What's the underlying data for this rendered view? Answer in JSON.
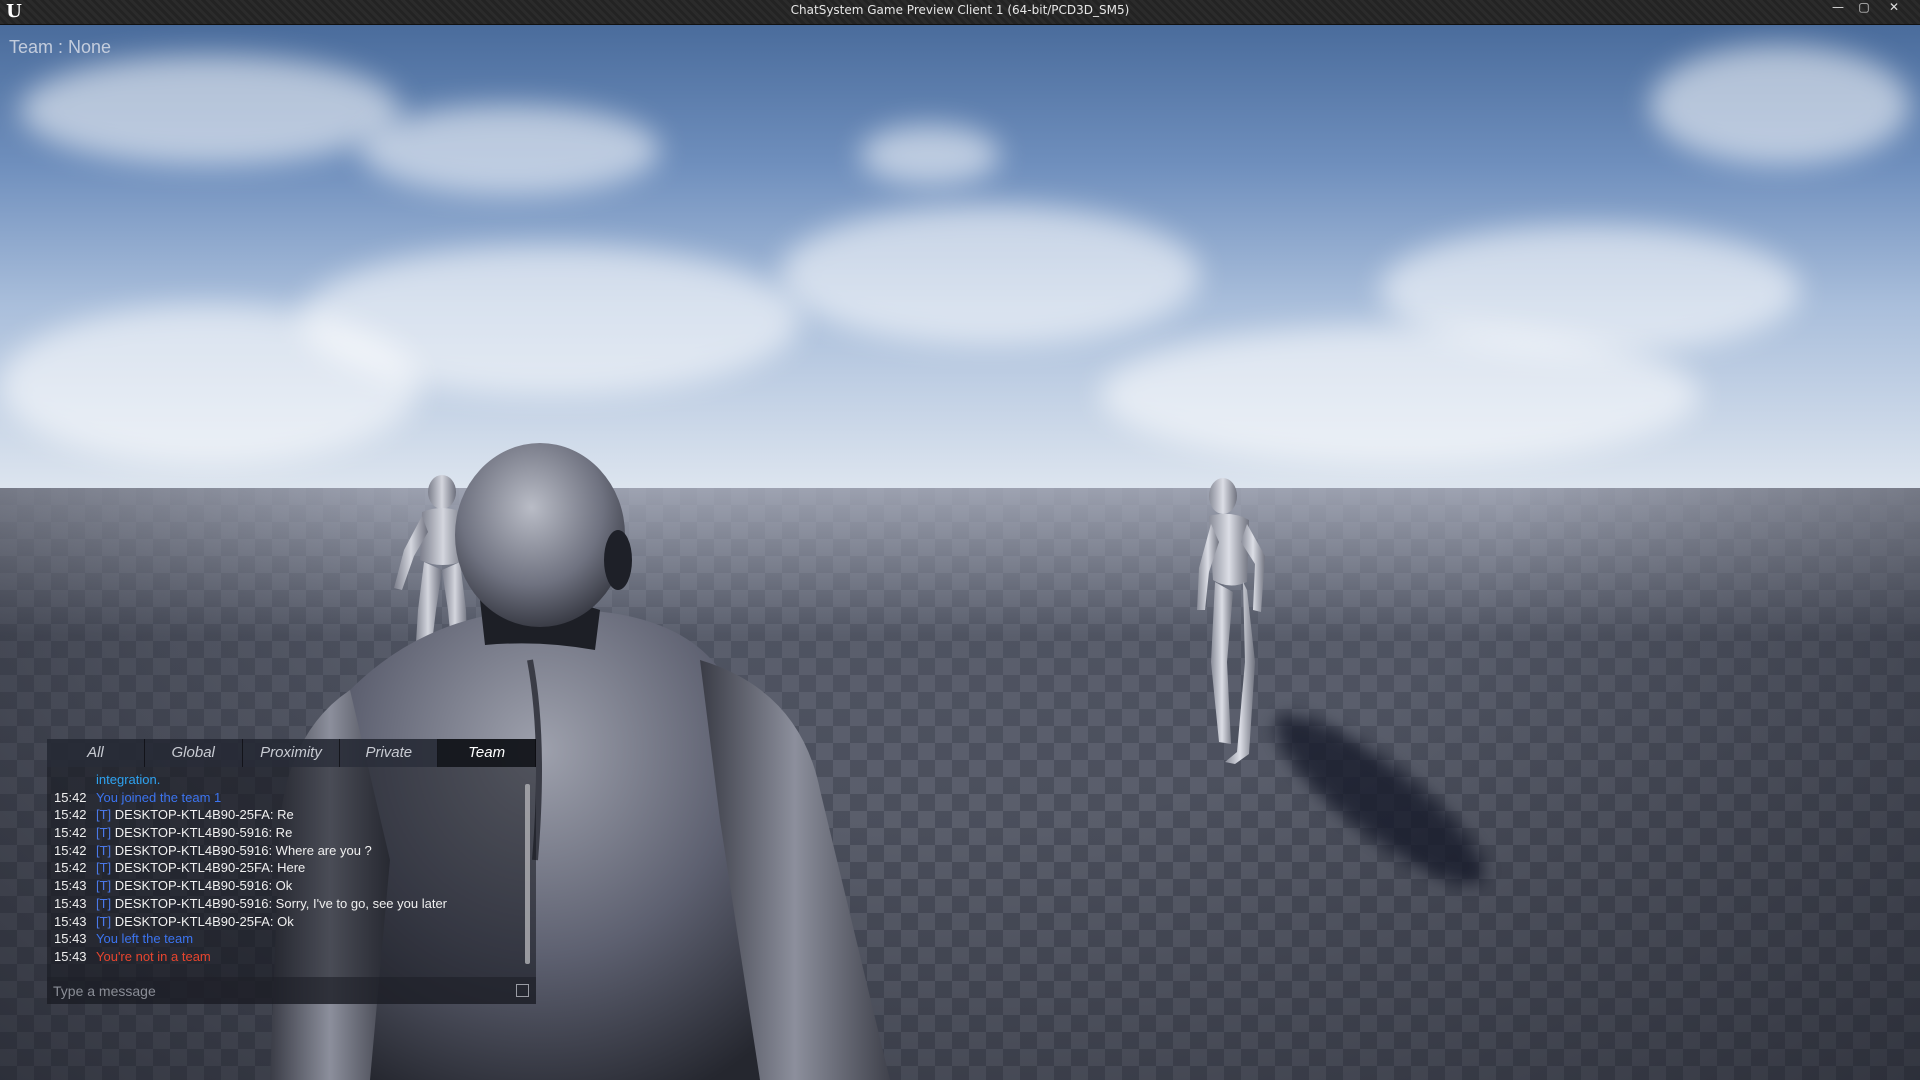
{
  "window": {
    "title": "ChatSystem Game Preview Client 1 (64-bit/PCD3D_SM5)",
    "logo": "U",
    "controls": {
      "minimize": "—",
      "maximize": "▢",
      "close": "✕"
    }
  },
  "hud": {
    "team_label": "Team : None"
  },
  "chat": {
    "tabs": [
      "All",
      "Global",
      "Proximity",
      "Private",
      "Team"
    ],
    "active_tab": "Team",
    "overflow_text": "integration.",
    "messages": [
      {
        "time": "15:42",
        "tag": "",
        "text": "You joined the team 1",
        "style": "sys-blue"
      },
      {
        "time": "15:42",
        "tag": "[T]",
        "text": " DESKTOP-KTL4B90-25FA: Re",
        "style": ""
      },
      {
        "time": "15:42",
        "tag": "[T]",
        "text": " DESKTOP-KTL4B90-5916: Re",
        "style": ""
      },
      {
        "time": "15:42",
        "tag": "[T]",
        "text": " DESKTOP-KTL4B90-5916: Where are you ?",
        "style": ""
      },
      {
        "time": "15:42",
        "tag": "[T]",
        "text": " DESKTOP-KTL4B90-25FA: Here",
        "style": ""
      },
      {
        "time": "15:43",
        "tag": "[T]",
        "text": " DESKTOP-KTL4B90-5916: Ok",
        "style": ""
      },
      {
        "time": "15:43",
        "tag": "[T]",
        "text": " DESKTOP-KTL4B90-5916: Sorry, I've to go, see you later",
        "style": ""
      },
      {
        "time": "15:43",
        "tag": "[T]",
        "text": " DESKTOP-KTL4B90-25FA: Ok",
        "style": ""
      },
      {
        "time": "15:43",
        "tag": "",
        "text": "You left the team",
        "style": "sys-blue"
      },
      {
        "time": "15:43",
        "tag": "",
        "text": "You're not in a team",
        "style": "sys-red"
      }
    ],
    "input_placeholder": "Type a message",
    "emoji_icon": "emoji-picker-icon"
  },
  "colors": {
    "sys_blue": "#3c74f0",
    "sys_red": "#e8452e",
    "team_tag": "#4a78e8"
  }
}
